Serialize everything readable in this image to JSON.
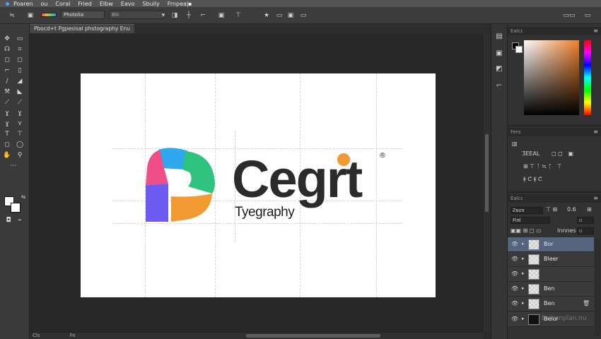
{
  "menubar": {
    "items": [
      "Poaren",
      "ou",
      "Coral",
      "Fried",
      "Elbw",
      "Eavo",
      "Sbuily",
      "Frnpea|ı"
    ]
  },
  "options": {
    "preset": "Photolia",
    "mode": "Blk"
  },
  "document": {
    "tab_label": "Pbocd+t Pgpesisal phstography",
    "tab_extra": "Enu",
    "status_left": "Cls",
    "status_right": "Fe"
  },
  "canvas": {
    "logo_word": "Cegrt",
    "logo_subtitle": "Tyegraphy",
    "reg_mark": "®",
    "logo_colors": {
      "pink": "#f04e87",
      "blue": "#2fa8f0",
      "green": "#2ec47f",
      "purple": "#6c5cf2",
      "orange": "#f29a32"
    }
  },
  "color_panel": {
    "title": "Ealcɪ",
    "fg_color": "#000000",
    "bg_color": "#ffffff",
    "accent_color": "#f07f2a"
  },
  "character_panel": {
    "title": "Fers",
    "row1": "ƷEEAL",
    "row2": "ǂ ᕦ ǂ ᕦ"
  },
  "layers_panel": {
    "title": "Ealcɪ",
    "kind_label": "Ƨɐƨɘ",
    "opacity_value": "0.6",
    "blend_label": "Innnes",
    "fill_label": "Fiɘl",
    "layers": [
      {
        "name": "Bor",
        "selected": true,
        "dark": false
      },
      {
        "name": "Bleer",
        "selected": false,
        "dark": false
      },
      {
        "name": "",
        "selected": false,
        "dark": false
      },
      {
        "name": "Ben",
        "selected": false,
        "dark": false
      },
      {
        "name": "Ben",
        "selected": false,
        "dark": false
      },
      {
        "name": "Belor",
        "selected": false,
        "dark": true
      }
    ],
    "watermark": "Ealcenplan.nu"
  }
}
